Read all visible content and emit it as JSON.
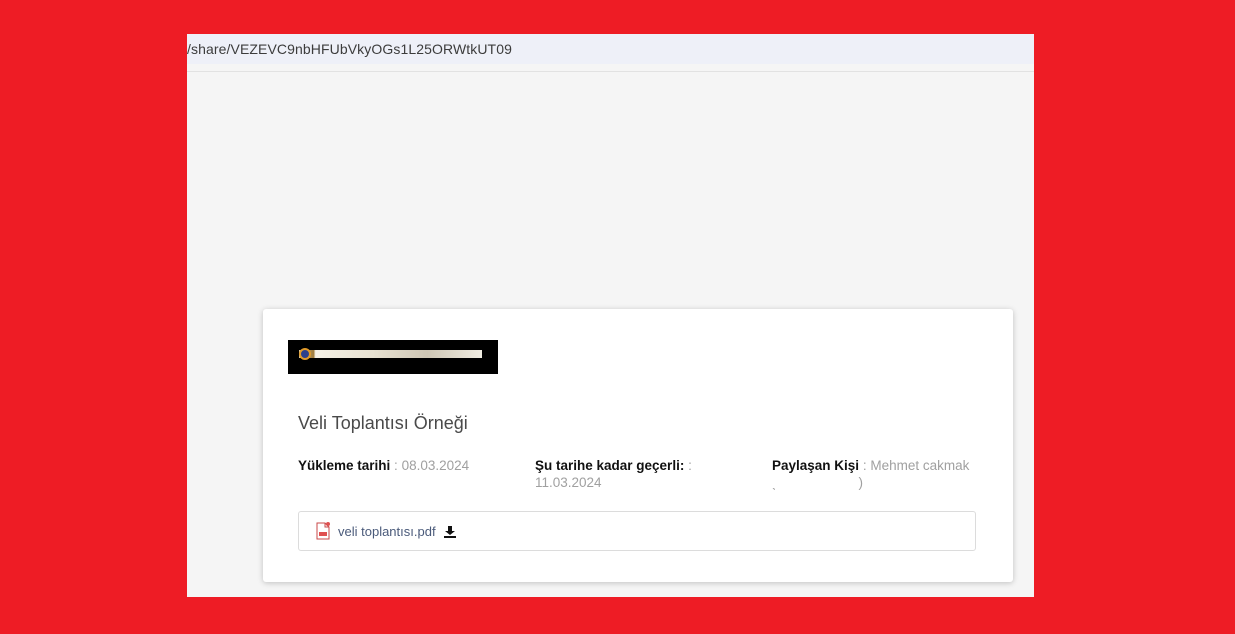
{
  "browser": {
    "url": "/share/VEZEVC9nbHFUbVkyOGs1L25ORWtkUT09"
  },
  "share": {
    "title": "Veli Toplantısı Örneği",
    "upload_label": "Yükleme tarihi",
    "upload_sep": " : ",
    "upload_value": "08.03.2024",
    "valid_label": "Şu tarihe kadar geçerli:",
    "valid_sep": " :",
    "valid_value": "11.03.2024",
    "sharer_label": "Paylaşan Kişi",
    "sharer_sep": " : ",
    "sharer_value": "Mehmet cakmak",
    "sharer_extra_open": "ˎ",
    "sharer_extra_close": ")"
  },
  "file": {
    "name": "veli toplantısı.pdf",
    "icon": "pdf-file-icon",
    "action_icon": "download-icon"
  },
  "colors": {
    "background": "#ee1c25",
    "page": "#f5f5f5",
    "card": "#ffffff",
    "file_link": "#4a5a7a"
  }
}
